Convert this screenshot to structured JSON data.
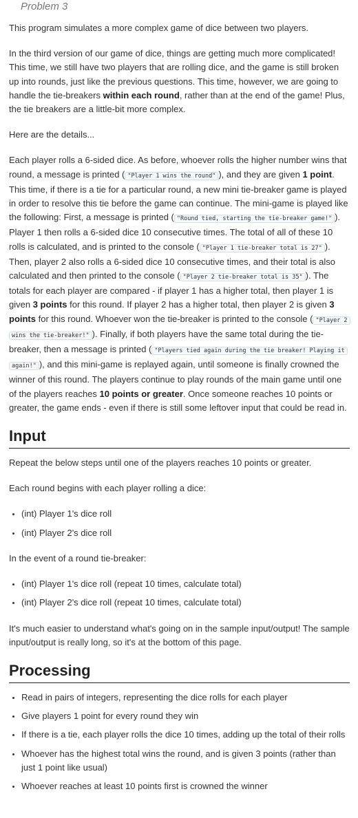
{
  "problem_title": "Problem 3",
  "intro": "This program simulates a more complex game of dice between two players.",
  "para2": {
    "t1": "In the third version of our game of dice, things are getting much more complicated! This time, we still have two players that are rolling dice, and the game is still broken up into rounds, just like the previous questions. This time, however, we are going to handle the tie-breakers ",
    "b1": "within each round",
    "t2": ", rather than at the end of the game! Plus, the tie breakers are a little-bit more complex."
  },
  "details_intro": "Here are the details...",
  "details": {
    "t1": "Each player rolls a 6-sided dice. As before, whoever rolls the higher number wins that round, a message is printed (",
    "c1": "\"Player 1 wins the round\"",
    "t2": "), and they are given ",
    "b1": "1 point",
    "t3": ". This time, if there is a tie for a particular round, a new mini tie-breaker game is played in order to resolve this tie before the game can continue. The mini-game is played like the following: First, a message is printed (",
    "c2": "\"Round tied, starting the tie-breaker game!\"",
    "t4": "). Player 1 then rolls a 6-sided dice 10 consecutive times. The total of all of these 10 rolls is calculated, and is printed to the console (",
    "c3": "\"Player 1 tie-breaker total is 27\"",
    "t5": "). Then, player 2 also rolls a 6-sided dice 10 consecutive times, and their total is also calculated and then printed to the console (",
    "c4": "\"Player 2 tie-breaker total is 35\"",
    "t6": "). The totals for each player are compared - if player 1 has a higher total, then player 1 is given ",
    "b2": "3 points",
    "t7": " for this round. If player 2 has a higher total, then player 2 is given ",
    "b3": "3 points",
    "t8": " for this round. Whoever won the tie-breaker is printed to the console (",
    "c5": "\"Player 2 wins the tie-breaker!\"",
    "t9": "). Finally, if both players have the same total during the tie-breaker, then a message is printed (",
    "c6": "\"Players tied again during the tie breaker! Playing it again!\"",
    "t10": "), and this mini-game is replayed again, until someone is finally crowned the winner of this round. The players continue to play rounds of the main game until one of the players reaches ",
    "b4": "10 points or greater",
    "t11": ". Once someone reaches 10 points or greater, the game ends - even if there is still some leftover input that could be read in."
  },
  "input_heading": "Input",
  "input_repeat": "Repeat the below steps until one of the players reaches 10 points or greater.",
  "input_round_intro": "Each round begins with each player rolling a dice:",
  "input_round_items": [
    "(int) Player 1's dice roll",
    "(int) Player 2's dice roll"
  ],
  "input_tie_intro": "In the event of a round tie-breaker:",
  "input_tie_items": [
    "(int) Player 1's dice roll (repeat 10 times, calculate total)",
    "(int) Player 2's dice roll (repeat 10 times, calculate total)"
  ],
  "input_note": "It's much easier to understand what's going on in the sample input/output! The sample input/output is really long, so it's at the bottom of this page.",
  "processing_heading": "Processing",
  "processing_items": [
    "Read in pairs of integers, representing the dice rolls for each player",
    "Give players 1 point for every round they win",
    "If there is a tie, each player rolls the dice 10 times, adding up the total of their rolls",
    "Whoever has the highest total wins the round, and is given 3 points (rather than just 1 point like usual)",
    "Whoever reaches at least 10 points first is crowned the winner"
  ]
}
